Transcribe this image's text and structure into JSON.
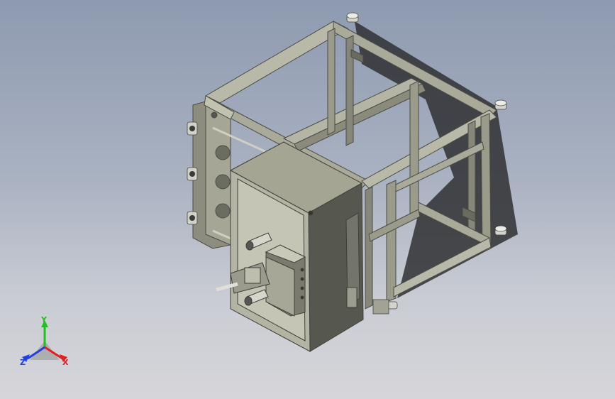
{
  "viewport": {
    "background_top": "#8e9ab0",
    "background_bottom": "#d6d6da"
  },
  "model": {
    "frame_color": "#a9aa99",
    "frame_dark": "#5f6055",
    "frame_shadow": "#2b2c2e",
    "panel_light": "#c2c2b1",
    "panel_mid": "#9c9c8c",
    "panel_dark": "#6c6d62"
  },
  "triad": {
    "x_label": "X",
    "y_label": "Y",
    "z_label": "Z",
    "x_color": "#e02020",
    "y_color": "#20c020",
    "z_color": "#2040e0"
  }
}
